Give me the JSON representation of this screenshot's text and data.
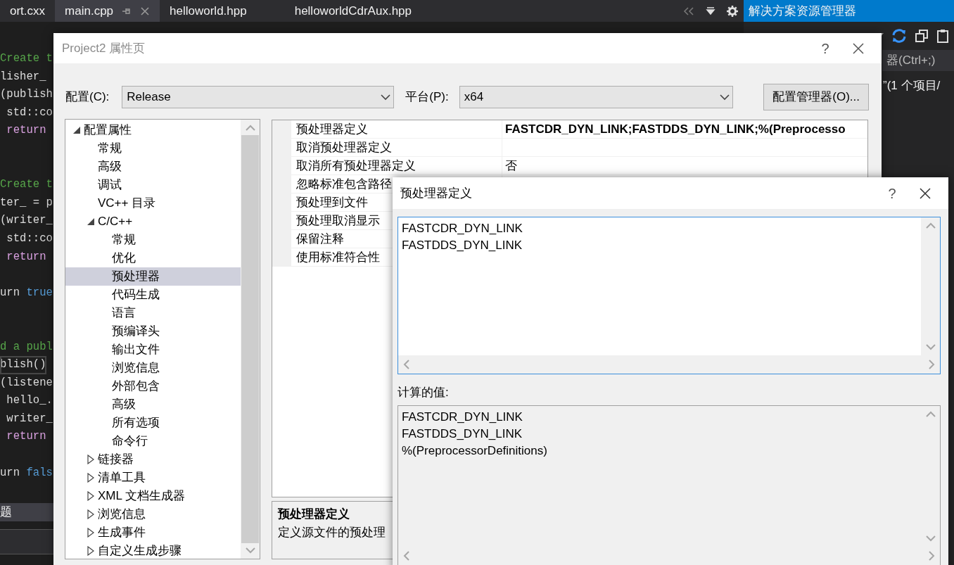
{
  "editor_tabs": [
    {
      "label": "ort.cxx",
      "selected": false
    },
    {
      "label": "main.cpp",
      "selected": true
    },
    {
      "label": "helloworld.hpp",
      "selected": false
    },
    {
      "label": "helloworldCdrAux.hpp",
      "selected": false
    }
  ],
  "solution_explorer": {
    "title": "解决方案资源管理器",
    "search_placeholder": "器(Ctrl+;)",
    "solution_line": "”(1 个项目/"
  },
  "code_lines": [
    {
      "kind": "code",
      "current": false,
      "segments": [
        {
          "kind": "comment",
          "text": "Create t"
        }
      ]
    },
    {
      "kind": "code",
      "current": false,
      "segments": [
        {
          "kind": "plain",
          "text": "lisher_"
        }
      ]
    },
    {
      "kind": "code",
      "current": false,
      "segments": [
        {
          "kind": "plain",
          "text": "(publish"
        }
      ]
    },
    {
      "kind": "code",
      "current": false,
      "segments": [
        {
          "kind": "plain",
          "text": " std::co"
        }
      ]
    },
    {
      "kind": "code",
      "current": false,
      "segments": [
        {
          "kind": "control",
          "text": " return"
        }
      ]
    },
    {
      "kind": "blank"
    },
    {
      "kind": "blank"
    },
    {
      "kind": "code",
      "current": false,
      "segments": [
        {
          "kind": "comment",
          "text": "Create t"
        }
      ]
    },
    {
      "kind": "code",
      "current": false,
      "segments": [
        {
          "kind": "plain",
          "text": "ter_ = p"
        }
      ]
    },
    {
      "kind": "code",
      "current": false,
      "segments": [
        {
          "kind": "plain",
          "text": "(writer_"
        }
      ]
    },
    {
      "kind": "code",
      "current": false,
      "segments": [
        {
          "kind": "plain",
          "text": " std::co"
        }
      ]
    },
    {
      "kind": "code",
      "current": false,
      "segments": [
        {
          "kind": "control",
          "text": " return"
        }
      ]
    },
    {
      "kind": "blank"
    },
    {
      "kind": "code",
      "current": false,
      "segments": [
        {
          "kind": "plain",
          "text": "urn "
        },
        {
          "kind": "keyword",
          "text": "true"
        }
      ]
    },
    {
      "kind": "blank"
    },
    {
      "kind": "blank"
    },
    {
      "kind": "code",
      "current": false,
      "segments": [
        {
          "kind": "comment",
          "text": "d a publ"
        }
      ]
    },
    {
      "kind": "code",
      "current": true,
      "segments": [
        {
          "kind": "plain",
          "text": "blish()"
        }
      ]
    },
    {
      "kind": "code",
      "current": false,
      "segments": [
        {
          "kind": "plain",
          "text": "(listene"
        }
      ]
    },
    {
      "kind": "code",
      "current": false,
      "segments": [
        {
          "kind": "plain",
          "text": " hello_."
        }
      ]
    },
    {
      "kind": "code",
      "current": false,
      "segments": [
        {
          "kind": "plain",
          "text": " writer_"
        }
      ]
    },
    {
      "kind": "code",
      "current": false,
      "segments": [
        {
          "kind": "control",
          "text": " return"
        }
      ]
    },
    {
      "kind": "blank"
    },
    {
      "kind": "code",
      "current": false,
      "segments": [
        {
          "kind": "plain",
          "text": "urn "
        },
        {
          "kind": "keyword",
          "text": "fals"
        }
      ]
    }
  ],
  "bottom_panel_tab": "题",
  "property_dialog": {
    "title": "Project2 属性页",
    "help": "?",
    "configuration": {
      "label": "配置(C):",
      "value": "Release"
    },
    "platform": {
      "label": "平台(P):",
      "value": "x64"
    },
    "manager_button": "配置管理器(O)...",
    "tree": [
      {
        "label": "配置属性",
        "expanded": true,
        "selected": false,
        "children": [
          {
            "label": "常规",
            "selected": false
          },
          {
            "label": "高级",
            "selected": false
          },
          {
            "label": "调试",
            "selected": false
          },
          {
            "label": "VC++ 目录",
            "selected": false
          },
          {
            "label": "C/C++",
            "expanded": true,
            "selected": false,
            "children": [
              {
                "label": "常规",
                "selected": false
              },
              {
                "label": "优化",
                "selected": false
              },
              {
                "label": "预处理器",
                "selected": true
              },
              {
                "label": "代码生成",
                "selected": false
              },
              {
                "label": "语言",
                "selected": false
              },
              {
                "label": "预编译头",
                "selected": false
              },
              {
                "label": "输出文件",
                "selected": false
              },
              {
                "label": "浏览信息",
                "selected": false
              },
              {
                "label": "外部包含",
                "selected": false
              },
              {
                "label": "高级",
                "selected": false
              },
              {
                "label": "所有选项",
                "selected": false
              },
              {
                "label": "命令行",
                "selected": false
              }
            ]
          },
          {
            "label": "链接器",
            "expanded": false,
            "selected": false
          },
          {
            "label": "清单工具",
            "expanded": false,
            "selected": false
          },
          {
            "label": "XML 文档生成器",
            "expanded": false,
            "selected": false
          },
          {
            "label": "浏览信息",
            "expanded": false,
            "selected": false
          },
          {
            "label": "生成事件",
            "expanded": false,
            "selected": false
          },
          {
            "label": "自定义生成步骤",
            "expanded": false,
            "selected": false
          }
        ]
      }
    ],
    "properties": [
      {
        "name": "预处理器定义",
        "value": "FASTCDR_DYN_LINK;FASTDDS_DYN_LINK;%(Preprocesso",
        "modified": true
      },
      {
        "name": "取消预处理器定义"
      },
      {
        "name": "取消所有预处理器定义",
        "value": "否",
        "modified": false
      },
      {
        "name": "忽略标准包含路径"
      },
      {
        "name": "预处理到文件"
      },
      {
        "name": "预处理取消显示"
      },
      {
        "name": "保留注释"
      },
      {
        "name": "使用标准符合性"
      }
    ],
    "description": {
      "title": "预处理器定义",
      "text": "定义源文件的预处理"
    }
  },
  "definitions_dialog": {
    "title": "预处理器定义",
    "help": "?",
    "lines": [
      "FASTCDR_DYN_LINK",
      "FASTDDS_DYN_LINK"
    ],
    "computed_label": "计算的值:",
    "computed_lines": [
      "FASTCDR_DYN_LINK",
      "FASTDDS_DYN_LINK",
      "%(PreprocessorDefinitions)"
    ]
  }
}
